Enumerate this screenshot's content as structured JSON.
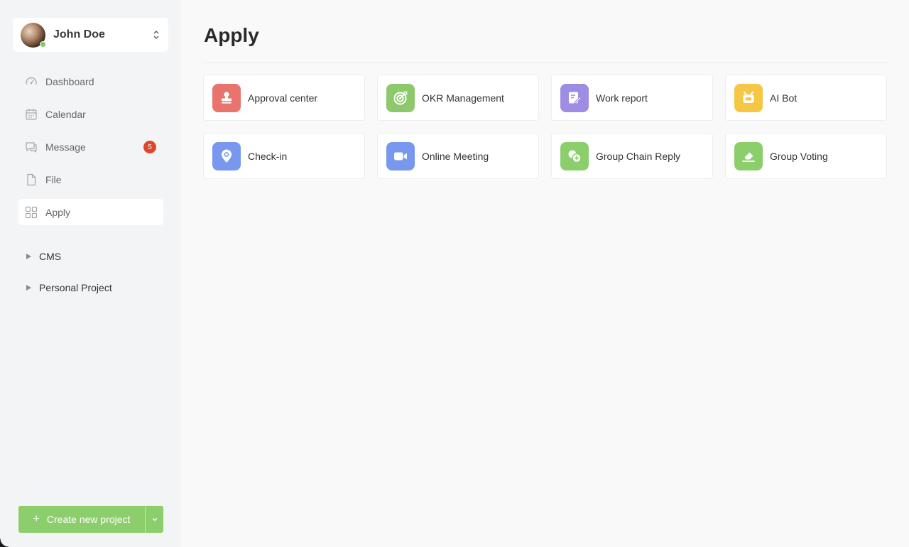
{
  "user": {
    "name": "John Doe",
    "status": "online"
  },
  "nav": [
    {
      "label": "Dashboard",
      "icon": "dashboard-icon"
    },
    {
      "label": "Calendar",
      "icon": "calendar-icon"
    },
    {
      "label": "Message",
      "icon": "message-icon",
      "badge": "5"
    },
    {
      "label": "File",
      "icon": "file-icon"
    },
    {
      "label": "Apply",
      "icon": "apps-grid-icon",
      "active": true
    }
  ],
  "tree": [
    {
      "label": "CMS"
    },
    {
      "label": "Personal Project"
    }
  ],
  "create_button": {
    "label": "Create new project"
  },
  "page": {
    "title": "Apply"
  },
  "apps": [
    {
      "label": "Approval center",
      "icon": "stamp-icon",
      "color": "#e9736d"
    },
    {
      "label": "OKR Management",
      "icon": "target-icon",
      "color": "#8dc86b"
    },
    {
      "label": "Work report",
      "icon": "report-edit-icon",
      "color": "#9d8ee3"
    },
    {
      "label": "AI Bot",
      "icon": "robot-icon",
      "color": "#f6c645"
    },
    {
      "label": "Check-in",
      "icon": "location-pin-icon",
      "color": "#7898ef"
    },
    {
      "label": "Online Meeting",
      "icon": "video-camera-icon",
      "color": "#7898ef"
    },
    {
      "label": "Group Chain Reply",
      "icon": "chat-add-icon",
      "color": "#8dce6c"
    },
    {
      "label": "Group Voting",
      "icon": "vote-icon",
      "color": "#8dce6c"
    }
  ],
  "colors": {
    "accent": "#8dce6c",
    "badge": "#e0472a"
  }
}
